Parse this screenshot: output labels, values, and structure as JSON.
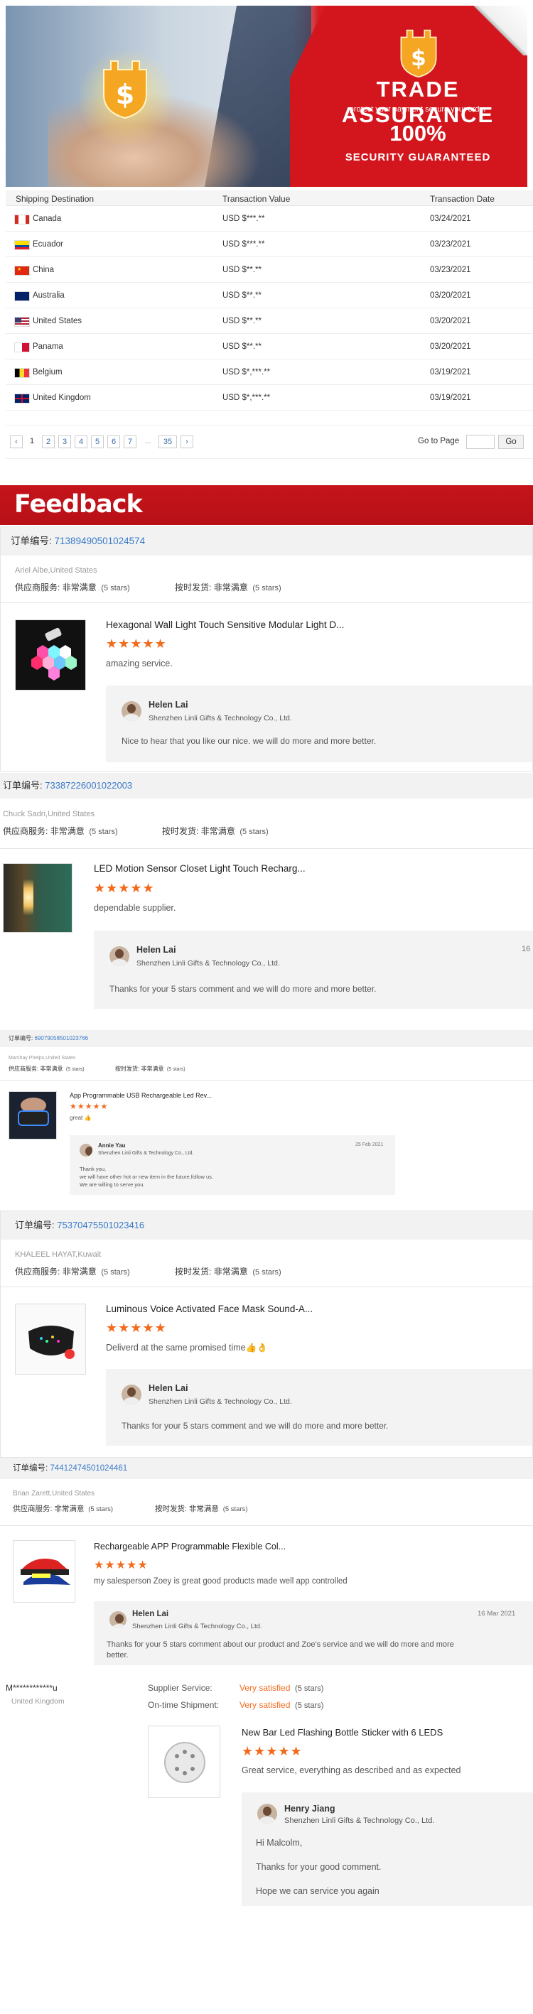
{
  "banner": {
    "title": "TRADE ASSURANCE",
    "subtitle": "protect your payment secure your order",
    "percent": "100%",
    "guarantee": "SECURITY GUARANTEED"
  },
  "transactions": {
    "headers": [
      "Shipping Destination",
      "Transaction Value",
      "Transaction Date"
    ],
    "rows": [
      {
        "country": "Canada",
        "value": "USD $***.**",
        "date": "03/24/2021",
        "flag": "ca"
      },
      {
        "country": "Ecuador",
        "value": "USD $***.**",
        "date": "03/23/2021",
        "flag": "ec"
      },
      {
        "country": "China",
        "value": "USD $**.**",
        "date": "03/23/2021",
        "flag": "cn"
      },
      {
        "country": "Australia",
        "value": "USD $**.**",
        "date": "03/20/2021",
        "flag": "au"
      },
      {
        "country": "United States",
        "value": "USD $**.**",
        "date": "03/20/2021",
        "flag": "us"
      },
      {
        "country": "Panama",
        "value": "USD $**.**",
        "date": "03/20/2021",
        "flag": "pa"
      },
      {
        "country": "Belgium",
        "value": "USD $*,***.**",
        "date": "03/19/2021",
        "flag": "be"
      },
      {
        "country": "United Kingdom",
        "value": "USD $*,***.**",
        "date": "03/19/2021",
        "flag": "gb"
      }
    ]
  },
  "pagination": {
    "prev": "‹",
    "pages": [
      "1",
      "2",
      "3",
      "4",
      "5",
      "6",
      "7"
    ],
    "dots": "...",
    "last": "35",
    "next": "›",
    "goto_label": "Go to Page",
    "go_button": "Go"
  },
  "feedback_title": "Feedback",
  "reviews": [
    {
      "order_label": "订单编号:",
      "order_no": "71389490501024574",
      "buyer": "Ariel Albe,United States",
      "supplier_label": "供应商服务:",
      "supplier_value": "非常满意",
      "supplier_stars": "(5 stars)",
      "ship_label": "按时发货:",
      "ship_value": "非常满意",
      "ship_stars": "(5 stars)",
      "product": "Hexagonal Wall Light Touch Sensitive Modular Light D...",
      "stars": "★★★★★",
      "comment": "amazing service.",
      "reply_name": "Helen Lai",
      "reply_company": "Shenzhen Linli Gifts & Technology Co., Ltd.",
      "reply_text": "Nice to hear that you like our nice. we will do more and more better."
    },
    {
      "order_label": "订单编号:",
      "order_no": "73387226001022003",
      "buyer": "Chuck Sadri,United States",
      "supplier_label": "供应商服务:",
      "supplier_value": "非常满意",
      "supplier_stars": "(5 stars)",
      "ship_label": "按时发货:",
      "ship_value": "非常满意",
      "ship_stars": "(5 stars)",
      "product": "LED Motion Sensor Closet Light Touch Recharg...",
      "stars": "★★★★★",
      "comment": "dependable supplier.",
      "reply_name": "Helen Lai",
      "reply_company": "Shenzhen Linli Gifts & Technology Co., Ltd.",
      "reply_text": "Thanks for your 5 stars comment and we will do more and more better.",
      "reply_date": "16"
    },
    {
      "order_label": "订单编号:",
      "order_no": "69079058501023766",
      "buyer": "Marshay Phelps,United States",
      "supplier_label": "供应商服务:",
      "supplier_value": "非常满意",
      "supplier_stars": "(5 stars)",
      "ship_label": "按时发货:",
      "ship_value": "非常满意",
      "ship_stars": "(5 stars)",
      "product": "App Programmable USB Rechargeable Led Rev...",
      "stars": "★★★★★",
      "comment": "great 👍",
      "reply_name": "Annie Yau",
      "reply_company": "Shenzhen Linli Gifts & Technology Co., Ltd.",
      "reply_date": "25 Feb 2021",
      "reply_lines": [
        "Thank you,",
        "we will have other hot or new item in the future,follow us.",
        "We are willing to serve you."
      ]
    },
    {
      "order_label": "订单编号:",
      "order_no": "75370475501023416",
      "buyer": "KHALEEL HAYAT,Kuwait",
      "supplier_label": "供应商服务:",
      "supplier_value": "非常满意",
      "supplier_stars": "(5 stars)",
      "ship_label": "按时发货:",
      "ship_value": "非常满意",
      "ship_stars": "(5 stars)",
      "product": "Luminous Voice Activated Face Mask Sound-A...",
      "stars": "★★★★★",
      "comment": "Deliverd at the same promised time👍👌",
      "reply_name": "Helen Lai",
      "reply_company": "Shenzhen Linli Gifts & Technology Co., Ltd.",
      "reply_text": "Thanks for your 5 stars comment and we will do more and more better."
    },
    {
      "order_label": "订单编号:",
      "order_no": "74412474501024461",
      "buyer": "Brian Zarett,United States",
      "supplier_label": "供应商服务:",
      "supplier_value": "非常满意",
      "supplier_stars": "(5 stars)",
      "ship_label": "按时发货:",
      "ship_value": "非常满意",
      "ship_stars": "(5 stars)",
      "product": "Rechargeable APP Programmable Flexible Col...",
      "stars": "★★★★★",
      "comment": "my salesperson Zoey is great good products made well app controlled",
      "reply_name": "Helen Lai",
      "reply_company": "Shenzhen Linli Gifts & Technology Co., Ltd.",
      "reply_date": "16 Mar 2021",
      "reply_lines": [
        "Thanks for your 5 stars comment about our product and Zoe's service and we will do more and more",
        "better."
      ]
    }
  ],
  "last_review": {
    "buyer": "M************u",
    "country": "United Kingdom",
    "supplier_label": "Supplier Service:",
    "supplier_value": "Very satisfied",
    "supplier_stars": "(5 stars)",
    "ship_label": "On-time Shipment:",
    "ship_value": "Very satisfied",
    "ship_stars": "(5 stars)",
    "product": "New Bar Led Flashing Bottle Sticker with 6 LEDS",
    "stars": "★★★★★",
    "comment": "Great service, everything as described and as expected",
    "reply_name": "Henry Jiang",
    "reply_company": "Shenzhen Linli Gifts & Technology Co., Ltd.",
    "reply_lines": [
      "Hi Malcolm,",
      "Thanks for your good comment.",
      "Hope we can service you again"
    ]
  }
}
